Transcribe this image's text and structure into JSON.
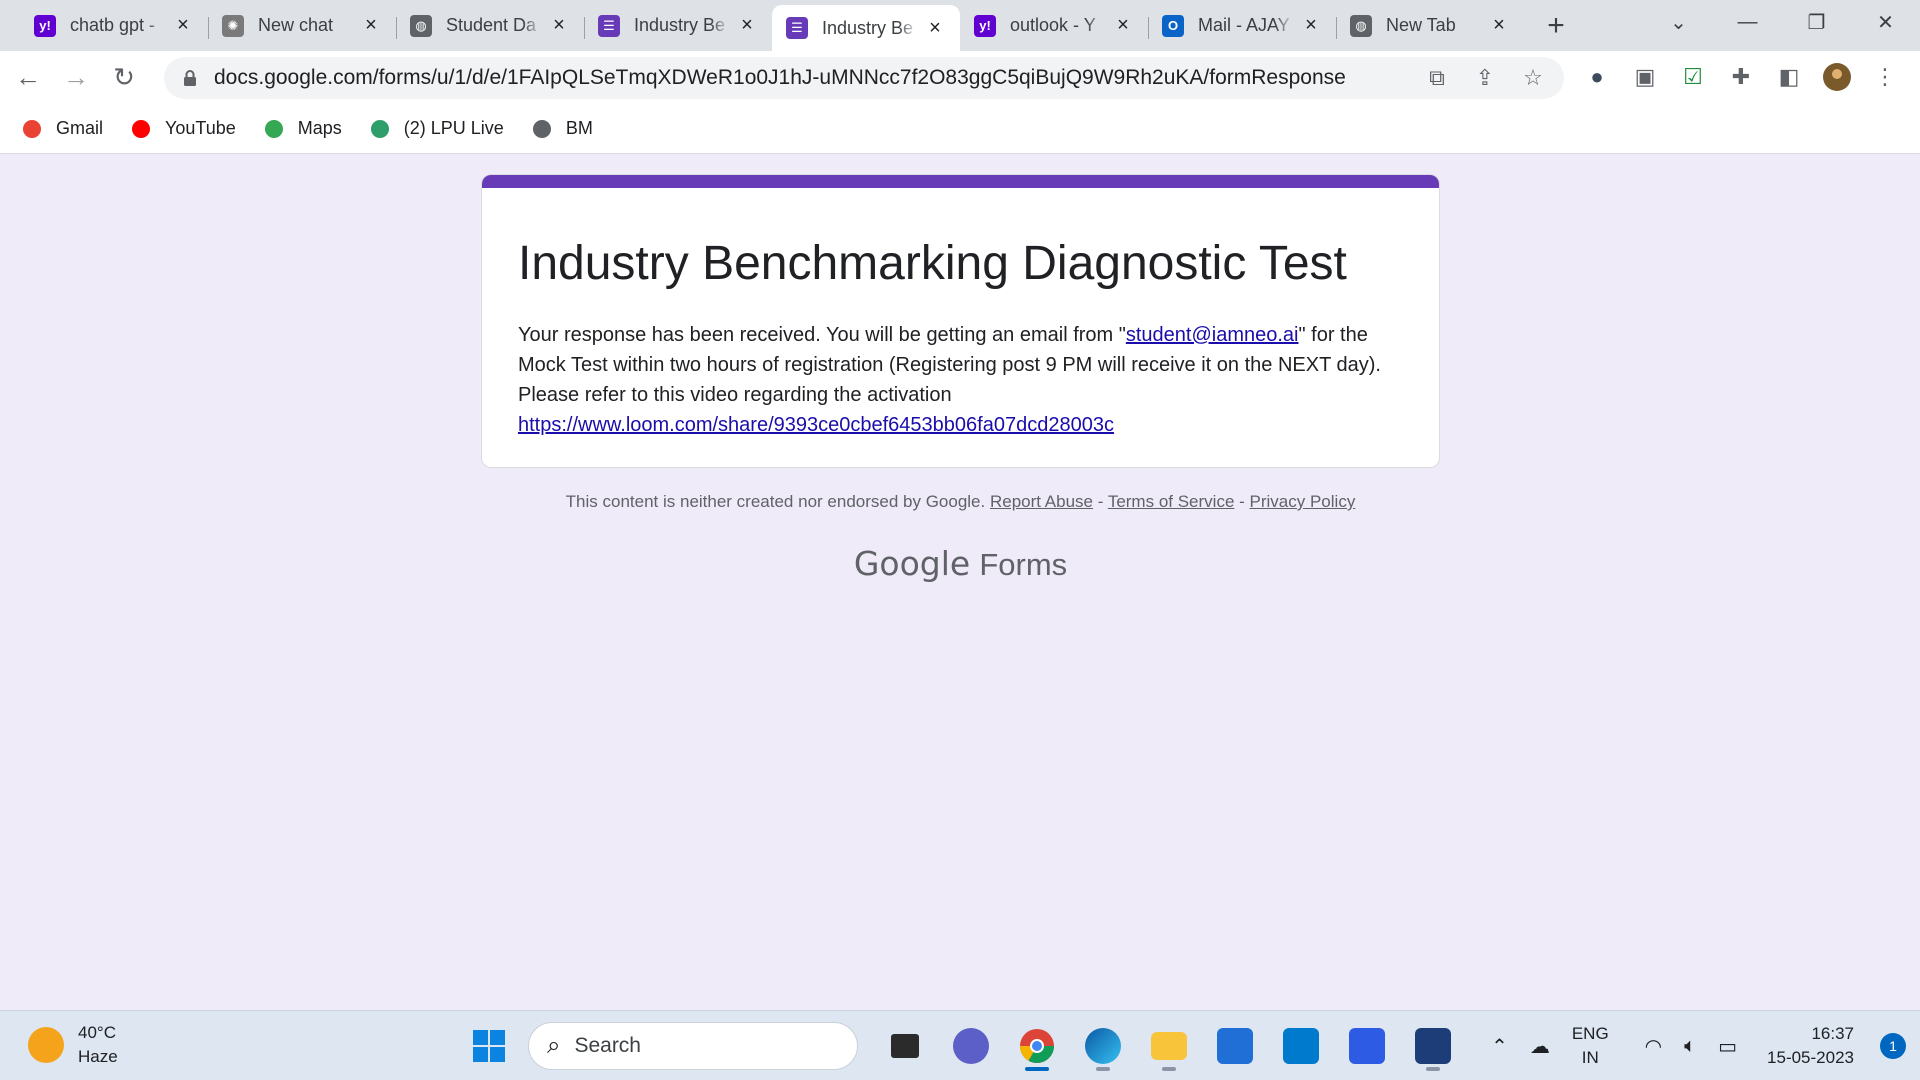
{
  "browser": {
    "tabs": [
      {
        "title": "chatb gpt -",
        "icon": "yahoo-icon",
        "color": "#6001d2",
        "glyph": "y!",
        "active": false
      },
      {
        "title": "New chat",
        "icon": "openai-icon",
        "color": "#7a7a7a",
        "glyph": "✺",
        "active": false
      },
      {
        "title": "Student Da",
        "icon": "globe-icon",
        "color": "#5f6368",
        "glyph": "◍",
        "active": false
      },
      {
        "title": "Industry Be",
        "icon": "forms-icon",
        "color": "#673ab7",
        "glyph": "☰",
        "active": false
      },
      {
        "title": "Industry Be",
        "icon": "forms-icon",
        "color": "#673ab7",
        "glyph": "☰",
        "active": true
      },
      {
        "title": "outlook - Y",
        "icon": "yahoo-icon",
        "color": "#6001d2",
        "glyph": "y!",
        "active": false
      },
      {
        "title": "Mail - AJAY",
        "icon": "outlook-icon",
        "color": "#0a64c8",
        "glyph": "O",
        "active": false
      },
      {
        "title": "New Tab",
        "icon": "globe-icon",
        "color": "#5f6368",
        "glyph": "◍",
        "active": false
      }
    ],
    "url": "docs.google.com/forms/u/1/d/e/1FAIpQLSeTmqXDWeR1o0J1hJ-uMNNcc7f2O83ggC5qiBujQ9W9Rh2uKA/formResponse",
    "bookmarks": [
      {
        "label": "Gmail",
        "icon": "gmail-icon",
        "color": "#ea4335"
      },
      {
        "label": "YouTube",
        "icon": "youtube-icon",
        "color": "#ff0000"
      },
      {
        "label": "Maps",
        "icon": "maps-icon",
        "color": "#34a853"
      },
      {
        "label": "(2) LPU Live",
        "icon": "lpu-live-icon",
        "color": "#2e9e6b"
      },
      {
        "label": "BM",
        "icon": "globe-icon",
        "color": "#5f6368"
      }
    ]
  },
  "form": {
    "title": "Industry Benchmarking Diagnostic Test",
    "message_before": "Your response has been received. You will be getting an email from \"",
    "email_link": "student@iamneo.ai",
    "message_after": "\" for the Mock Test within two hours of registration (Registering post 9 PM will receive it on the NEXT day). Please refer to this video regarding the activation",
    "video_link": "https://www.loom.com/share/9393ce0cbef6453bb06fa07dcd28003c",
    "accent_color": "#673ab7"
  },
  "footer": {
    "disclaimer": "This content is neither created nor endorsed by Google.",
    "report_abuse": "Report Abuse",
    "terms": "Terms of Service",
    "privacy": "Privacy Policy",
    "sep": " - ",
    "brand_google": "Google",
    "brand_forms": "Forms"
  },
  "taskbar": {
    "temperature": "40°C",
    "condition": "Haze",
    "search_placeholder": "Search",
    "lang_line1": "ENG",
    "lang_line2": "IN",
    "time": "16:37",
    "date": "15-05-2023",
    "notification_count": "1"
  }
}
